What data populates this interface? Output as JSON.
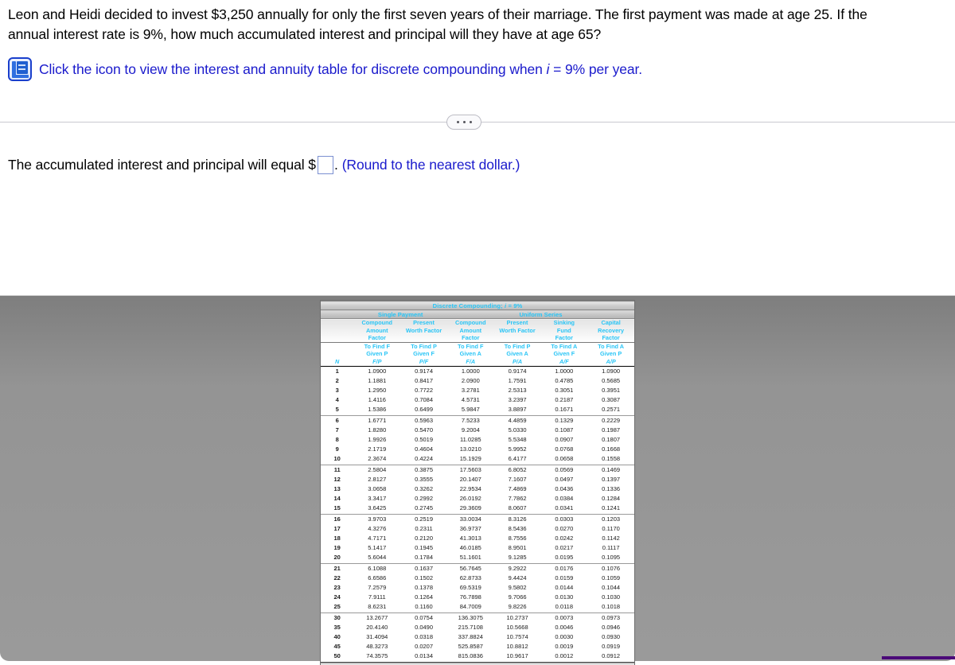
{
  "question": {
    "line1": "Leon and Heidi decided to invest $3,250 annually for only the first seven years of their marriage. The first payment was made at age 25. If the",
    "line2": "annual interest rate is 9%, how much accumulated interest and principal will they have at age 65?",
    "icon_name": "table-book-icon",
    "icon_link_pre": "Click the icon to view the interest and annuity table for discrete compounding when ",
    "icon_link_var": "i",
    "icon_link_post": " = 9% per year."
  },
  "divider": {
    "expand_label": "•••"
  },
  "answer": {
    "prompt": "The accumulated interest and principal will equal $",
    "input_value": "",
    "input_placeholder": "",
    "period": ".",
    "hint": "(Round to the nearest dollar.)"
  },
  "table": {
    "title": "Discrete Compounding;",
    "title_var": "i",
    "title_rate": "= 9%",
    "group_single": "Single Payment",
    "group_uniform": "Uniform Series",
    "col_titles": [
      "Compound\nAmount\nFactor",
      "Present\nWorth Factor",
      "Compound\nAmount\nFactor",
      "Present\nWorth Factor",
      "Sinking\nFund\nFactor",
      "Capital\nRecovery\nFactor"
    ],
    "col_titles_flat": {
      "c1_l1": "Compound",
      "c1_l2": "Amount",
      "c1_l3": "Factor",
      "c2_l1": "Present",
      "c2_l2": "Worth Factor",
      "c2_l3": "",
      "c3_l1": "Compound",
      "c3_l2": "Amount",
      "c3_l3": "Factor",
      "c4_l1": "Present",
      "c4_l2": "Worth Factor",
      "c4_l3": "",
      "c5_l1": "Sinking",
      "c5_l2": "Fund",
      "c5_l3": "Factor",
      "c6_l1": "Capital",
      "c6_l2": "Recovery",
      "c6_l3": "Factor"
    },
    "find_given": {
      "n_label": "N",
      "c1": {
        "find": "To Find F",
        "given": "Given P",
        "ratio": "F/P"
      },
      "c2": {
        "find": "To Find P",
        "given": "Given F",
        "ratio": "P/F"
      },
      "c3": {
        "find": "To Find F",
        "given": "Given A",
        "ratio": "F/A"
      },
      "c4": {
        "find": "To Find P",
        "given": "Given A",
        "ratio": "P/A"
      },
      "c5": {
        "find": "To Find A",
        "given": "Given F",
        "ratio": "A/F"
      },
      "c6": {
        "find": "To Find A",
        "given": "Given P",
        "ratio": "A/P"
      }
    },
    "headers": [
      "N",
      "F/P",
      "P/F",
      "F/A",
      "P/A",
      "A/F",
      "A/P"
    ],
    "rows": [
      [
        "1",
        "1.0900",
        "0.9174",
        "1.0000",
        "0.9174",
        "1.0000",
        "1.0900"
      ],
      [
        "2",
        "1.1881",
        "0.8417",
        "2.0900",
        "1.7591",
        "0.4785",
        "0.5685"
      ],
      [
        "3",
        "1.2950",
        "0.7722",
        "3.2781",
        "2.5313",
        "0.3051",
        "0.3951"
      ],
      [
        "4",
        "1.4116",
        "0.7084",
        "4.5731",
        "3.2397",
        "0.2187",
        "0.3087"
      ],
      [
        "5",
        "1.5386",
        "0.6499",
        "5.9847",
        "3.8897",
        "0.1671",
        "0.2571"
      ],
      [
        "6",
        "1.6771",
        "0.5963",
        "7.5233",
        "4.4859",
        "0.1329",
        "0.2229"
      ],
      [
        "7",
        "1.8280",
        "0.5470",
        "9.2004",
        "5.0330",
        "0.1087",
        "0.1987"
      ],
      [
        "8",
        "1.9926",
        "0.5019",
        "11.0285",
        "5.5348",
        "0.0907",
        "0.1807"
      ],
      [
        "9",
        "2.1719",
        "0.4604",
        "13.0210",
        "5.9952",
        "0.0768",
        "0.1668"
      ],
      [
        "10",
        "2.3674",
        "0.4224",
        "15.1929",
        "6.4177",
        "0.0658",
        "0.1558"
      ],
      [
        "11",
        "2.5804",
        "0.3875",
        "17.5603",
        "6.8052",
        "0.0569",
        "0.1469"
      ],
      [
        "12",
        "2.8127",
        "0.3555",
        "20.1407",
        "7.1607",
        "0.0497",
        "0.1397"
      ],
      [
        "13",
        "3.0658",
        "0.3262",
        "22.9534",
        "7.4869",
        "0.0436",
        "0.1336"
      ],
      [
        "14",
        "3.3417",
        "0.2992",
        "26.0192",
        "7.7862",
        "0.0384",
        "0.1284"
      ],
      [
        "15",
        "3.6425",
        "0.2745",
        "29.3609",
        "8.0607",
        "0.0341",
        "0.1241"
      ],
      [
        "16",
        "3.9703",
        "0.2519",
        "33.0034",
        "8.3126",
        "0.0303",
        "0.1203"
      ],
      [
        "17",
        "4.3276",
        "0.2311",
        "36.9737",
        "8.5436",
        "0.0270",
        "0.1170"
      ],
      [
        "18",
        "4.7171",
        "0.2120",
        "41.3013",
        "8.7556",
        "0.0242",
        "0.1142"
      ],
      [
        "19",
        "5.1417",
        "0.1945",
        "46.0185",
        "8.9501",
        "0.0217",
        "0.1117"
      ],
      [
        "20",
        "5.6044",
        "0.1784",
        "51.1601",
        "9.1285",
        "0.0195",
        "0.1095"
      ],
      [
        "21",
        "6.1088",
        "0.1637",
        "56.7645",
        "9.2922",
        "0.0176",
        "0.1076"
      ],
      [
        "22",
        "6.6586",
        "0.1502",
        "62.8733",
        "9.4424",
        "0.0159",
        "0.1059"
      ],
      [
        "23",
        "7.2579",
        "0.1378",
        "69.5319",
        "9.5802",
        "0.0144",
        "0.1044"
      ],
      [
        "24",
        "7.9111",
        "0.1264",
        "76.7898",
        "9.7066",
        "0.0130",
        "0.1030"
      ],
      [
        "25",
        "8.6231",
        "0.1160",
        "84.7009",
        "9.8226",
        "0.0118",
        "0.1018"
      ],
      [
        "30",
        "13.2677",
        "0.0754",
        "136.3075",
        "10.2737",
        "0.0073",
        "0.0973"
      ],
      [
        "35",
        "20.4140",
        "0.0490",
        "215.7108",
        "10.5668",
        "0.0046",
        "0.0946"
      ],
      [
        "40",
        "31.4094",
        "0.0318",
        "337.8824",
        "10.7574",
        "0.0030",
        "0.0930"
      ],
      [
        "45",
        "48.3273",
        "0.0207",
        "525.8587",
        "10.8812",
        "0.0019",
        "0.0919"
      ],
      [
        "50",
        "74.3575",
        "0.0134",
        "815.0836",
        "10.9617",
        "0.0012",
        "0.0912"
      ]
    ],
    "group_breaks": [
      5,
      10,
      15,
      20,
      25
    ]
  },
  "colors": {
    "link_blue": "#1a1acc",
    "header_cyan": "#29c5f6",
    "backdrop_gray": "#949494",
    "accent_purple": "#4b0a78"
  }
}
